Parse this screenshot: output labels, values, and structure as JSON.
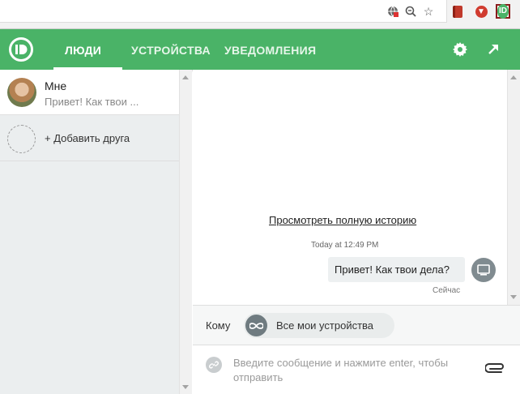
{
  "colors": {
    "accent": "#4ab367",
    "sidebar_bg": "#ebeeef",
    "bubble_bg": "#edf0f1"
  },
  "browser": {
    "icons": [
      "globe-icon",
      "zoom-icon",
      "star-icon",
      "bookmark-icon",
      "opera-icon",
      "pushbullet-icon"
    ]
  },
  "header": {
    "tabs": [
      {
        "label": "ЛЮДИ",
        "active": true
      },
      {
        "label": "УСТРОЙСТВА",
        "active": false
      },
      {
        "label": "УВЕДОМЛЕНИЯ",
        "active": false
      }
    ],
    "icons": [
      "gear-icon",
      "popout-icon"
    ]
  },
  "sidebar": {
    "contacts": [
      {
        "name": "Мне",
        "preview": "Привет! Как твои ..."
      }
    ],
    "add_friend_label": "+ Добавить друга"
  },
  "chat": {
    "history_link": "Просмотреть полную историю",
    "timestamp": "Today at 12:49 PM",
    "messages": [
      {
        "text": "Привет! Как твои дела?",
        "status": "Сейчас"
      }
    ]
  },
  "composer": {
    "to_label": "Кому",
    "target": "Все мои устройства",
    "placeholder": "Введите сообщение и нажмите enter, чтобы отправить",
    "value": ""
  }
}
